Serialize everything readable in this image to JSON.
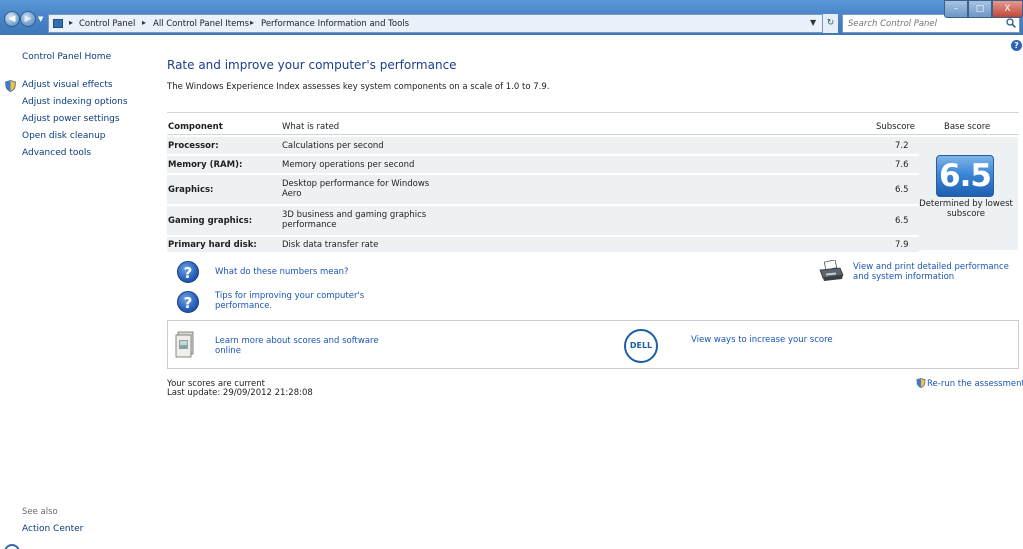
{
  "window": {
    "breadcrumb": [
      "Control Panel",
      "All Control Panel Items",
      "Performance Information and Tools"
    ],
    "search_placeholder": "Search Control Panel",
    "min_label": "–",
    "max_label": "□",
    "close_label": "X"
  },
  "sidebar": {
    "home": "Control Panel Home",
    "items": [
      {
        "label": "Adjust visual effects",
        "icon": "shield-icon"
      },
      {
        "label": "Adjust indexing options"
      },
      {
        "label": "Adjust power settings"
      },
      {
        "label": "Open disk cleanup"
      },
      {
        "label": "Advanced tools"
      }
    ],
    "see_also": "See also",
    "action_center": "Action Center"
  },
  "main": {
    "title": "Rate and improve your computer's performance",
    "description": "The Windows Experience Index assesses key system components on a scale of 1.0 to 7.9.",
    "table": {
      "headers": {
        "component": "Component",
        "rated": "What is rated",
        "subscore": "Subscore",
        "base": "Base score"
      },
      "rows": [
        {
          "component": "Processor:",
          "rated": "Calculations per second",
          "subscore": "7.2"
        },
        {
          "component": "Memory (RAM):",
          "rated": "Memory operations per second",
          "subscore": "7.6"
        },
        {
          "component": "Graphics:",
          "rated": "Desktop performance for Windows Aero",
          "subscore": "6.5"
        },
        {
          "component": "Gaming graphics:",
          "rated": "3D business and gaming graphics performance",
          "subscore": "6.5"
        },
        {
          "component": "Primary hard disk:",
          "rated": "Disk data transfer rate",
          "subscore": "7.9"
        }
      ],
      "base_score": "6.5",
      "base_note": "Determined by lowest subscore"
    },
    "links": {
      "numbers_mean": "What do these numbers mean?",
      "tips": "Tips for improving your computer's performance.",
      "print": "View and print detailed performance and system information",
      "learn_more": "Learn more about scores and software online",
      "increase": "View ways to increase your score",
      "rerun": "Re-run the assessment"
    },
    "dell_logo": "DELL",
    "status": {
      "current": "Your scores are current",
      "last_update": "Last update: 29/09/2012 21:28:08"
    }
  },
  "colors": {
    "link": "#1a56b5",
    "title": "#1c3e8a",
    "tile": "#3b86d8"
  }
}
